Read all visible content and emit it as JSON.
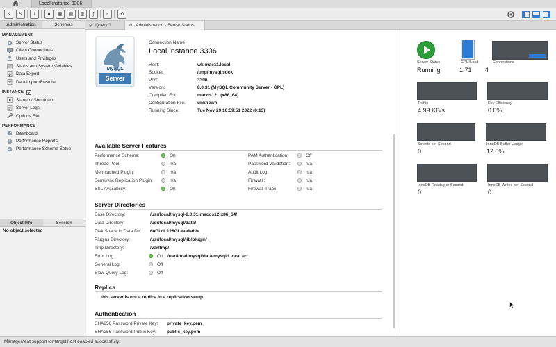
{
  "window": {
    "connection_tab": "Local instance 3306",
    "status_message": "Management support for target host enabled successfully."
  },
  "sidebar": {
    "tabs": [
      "Administration",
      "Schemas"
    ],
    "sections": {
      "management": {
        "title": "MANAGEMENT",
        "items": [
          "Server Status",
          "Client Connections",
          "Users and Privileges",
          "Status and System Variables",
          "Data Export",
          "Data Import/Restore"
        ]
      },
      "instance": {
        "title": "INSTANCE",
        "items": [
          "Startup / Shutdown",
          "Server Logs",
          "Options File"
        ]
      },
      "performance": {
        "title": "PERFORMANCE",
        "items": [
          "Dashboard",
          "Performance Reports",
          "Performance Schema Setup"
        ]
      }
    },
    "info_tabs": [
      "Object Info",
      "Session"
    ],
    "no_object": "No object selected"
  },
  "doc_tabs": [
    "Query 1",
    "Administration - Server Status"
  ],
  "logo": {
    "line1": "MySQL",
    "line2": "Server"
  },
  "connection": {
    "name_label": "Connection Name",
    "name": "Local instance 3306",
    "rows": [
      {
        "label": "Host:",
        "value": "wk-mac11.local"
      },
      {
        "label": "Socket:",
        "value": "/tmp/mysql.sock"
      },
      {
        "label": "Port:",
        "value": "3306"
      },
      {
        "label": "Version:",
        "value": "8.0.31 (MySQL Community Server - GPL)"
      },
      {
        "label": "Compiled For:",
        "value": "macos12   (x86_64)"
      },
      {
        "label": "Configuration File:",
        "value": "unknown"
      },
      {
        "label": "Running Since:",
        "value": "Tue Nov 29 16:59:51 2022 (0:13)"
      }
    ]
  },
  "features": {
    "title": "Available Server Features",
    "left": [
      {
        "label": "Performance Schema:",
        "state": "on",
        "value": "On"
      },
      {
        "label": "Thread Pool:",
        "state": "off",
        "value": "n/a"
      },
      {
        "label": "Memcached Plugin:",
        "state": "off",
        "value": "n/a"
      },
      {
        "label": "Semisync Replication Plugin:",
        "state": "off",
        "value": "n/a"
      },
      {
        "label": "SSL Availability:",
        "state": "on",
        "value": "On"
      }
    ],
    "right": [
      {
        "label": "PAM Authentication:",
        "state": "off",
        "value": "Off"
      },
      {
        "label": "Password Validation:",
        "state": "off",
        "value": "n/a"
      },
      {
        "label": "Audit Log:",
        "state": "off",
        "value": "n/a"
      },
      {
        "label": "Firewall:",
        "state": "off",
        "value": "n/a"
      },
      {
        "label": "Firewall Trace:",
        "state": "off",
        "value": "n/a"
      }
    ]
  },
  "directories": {
    "title": "Server Directories",
    "rows": [
      {
        "label": "Base Directory:",
        "value": "/usr/local/mysql-8.0.31-macos12-x86_64/"
      },
      {
        "label": "Data Directory:",
        "value": "/usr/local/mysql/data/"
      },
      {
        "label": "Disk Space in Data Dir:",
        "value": "60Gi of 128Gi available"
      },
      {
        "label": "Plugins Directory:",
        "value": "/usr/local/mysql/lib/plugin/"
      },
      {
        "label": "Tmp Directory:",
        "value": "/var/tmp/"
      }
    ],
    "logs": [
      {
        "label": "Error Log:",
        "state": "on",
        "value": "On",
        "path": "/usr/local/mysql/data/mysqld.local.err"
      },
      {
        "label": "General Log:",
        "state": "off",
        "value": "Off"
      },
      {
        "label": "Slow Query Log:",
        "state": "off",
        "value": "Off"
      }
    ]
  },
  "replica": {
    "title": "Replica",
    "text": "this server is not a replica in a replication setup"
  },
  "authentication": {
    "title": "Authentication",
    "rows": [
      {
        "label": "SHA256 Password Private Key:",
        "value": "private_key.pem"
      },
      {
        "label": "SHA256 Password Public Key:",
        "value": "public_key.pem"
      }
    ]
  },
  "status_panel": {
    "server_status_label": "Server Status",
    "server_status_value": "Running",
    "cpu_label": "CPU/Load",
    "cpu_value": "1.71",
    "cpu_load_fraction": 0.95,
    "connections_label": "Connections",
    "connections_value": "4",
    "connections_fill_fraction": 0.2,
    "graphs": [
      {
        "label": "Traffic",
        "value": "4.99 KB/s"
      },
      {
        "label": "Key Efficiency",
        "value": "0.0%"
      },
      {
        "label": "Selects per Second",
        "value": "0"
      },
      {
        "label": "InnoDB Buffer Usage",
        "value": "12.0%"
      },
      {
        "label": "InnoDB Reads per Second",
        "value": "0"
      },
      {
        "label": "InnoDB Writes per Second",
        "value": "0"
      }
    ],
    "colors": {
      "graph_bg": "#4d5257",
      "accent_blue": "#2f7bd6",
      "running_green": "#2e9e3a"
    }
  }
}
